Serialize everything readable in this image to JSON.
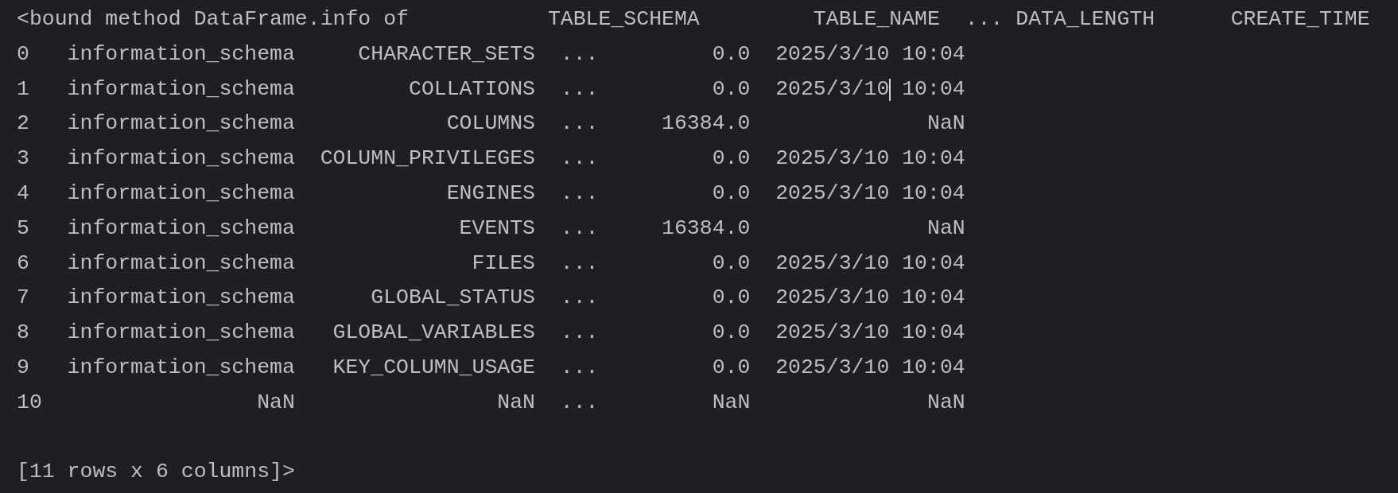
{
  "lines": [
    {
      "text": "<bound method DataFrame.info of           TABLE_SCHEMA         TABLE_NAME  ... DATA_LENGTH      CREATE_TIME",
      "cursor": false
    },
    {
      "text": "0   information_schema     CHARACTER_SETS  ...         0.0  2025/3/10 10:04",
      "cursor": false
    },
    {
      "text": "1   information_schema         COLLATIONS  ...         0.0  2025/3/10 10:04",
      "cursor": true
    },
    {
      "text": "2   information_schema            COLUMNS  ...     16384.0              NaN",
      "cursor": false
    },
    {
      "text": "3   information_schema  COLUMN_PRIVILEGES  ...         0.0  2025/3/10 10:04",
      "cursor": false
    },
    {
      "text": "4   information_schema            ENGINES  ...         0.0  2025/3/10 10:04",
      "cursor": false
    },
    {
      "text": "5   information_schema             EVENTS  ...     16384.0              NaN",
      "cursor": false
    },
    {
      "text": "6   information_schema              FILES  ...         0.0  2025/3/10 10:04",
      "cursor": false
    },
    {
      "text": "7   information_schema      GLOBAL_STATUS  ...         0.0  2025/3/10 10:04",
      "cursor": false
    },
    {
      "text": "8   information_schema   GLOBAL_VARIABLES  ...         0.0  2025/3/10 10:04",
      "cursor": false
    },
    {
      "text": "9   information_schema   KEY_COLUMN_USAGE  ...         0.0  2025/3/10 10:04",
      "cursor": false
    },
    {
      "text": "10                 NaN                NaN  ...         NaN              NaN",
      "cursor": false
    }
  ],
  "footer": "[11 rows x 6 columns]>"
}
